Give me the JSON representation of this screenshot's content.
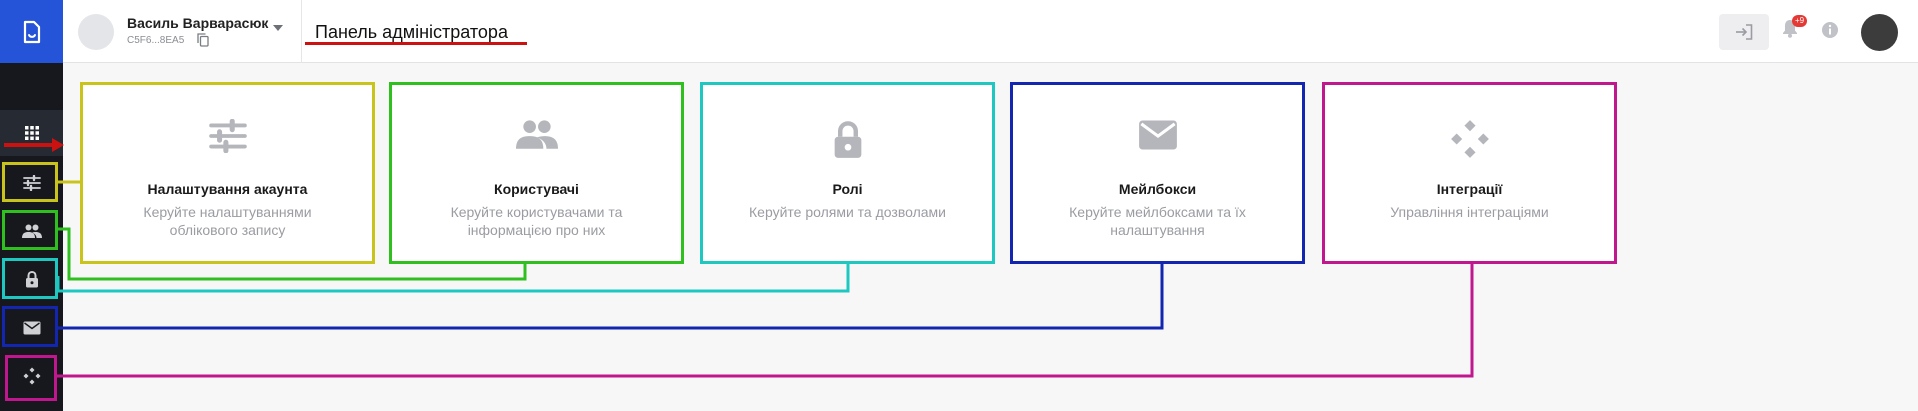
{
  "colors": {
    "logo_bg": "#2554d8",
    "sidebar_bg": "#16181d",
    "card_account": "#c9c41b",
    "card_users": "#2fbf1f",
    "card_roles": "#1ec8c0",
    "card_mailboxes": "#1226b0",
    "card_integrations": "#c0168e",
    "arrow": "#cc1111"
  },
  "header": {
    "user_name": "Василь Варварасюк",
    "user_id": "C5F6...8EA5",
    "page_title": "Панель адміністратора",
    "notifications_badge": "+9"
  },
  "sidebar": {
    "items": [
      {
        "icon": "grid-icon"
      },
      {
        "icon": "sliders-icon"
      },
      {
        "icon": "users-icon"
      },
      {
        "icon": "lock-icon"
      },
      {
        "icon": "mail-icon"
      },
      {
        "icon": "integrations-icon"
      }
    ]
  },
  "cards": [
    {
      "icon": "sliders-icon",
      "title": "Налаштування акаунта",
      "desc": "Керуйте налаштуваннями облікового запису"
    },
    {
      "icon": "users-icon",
      "title": "Користувачі",
      "desc": "Керуйте користувачами та інформацією про них"
    },
    {
      "icon": "lock-icon",
      "title": "Ролі",
      "desc": "Керуйте ролями та дозволами"
    },
    {
      "icon": "mail-icon",
      "title": "Мейлбокси",
      "desc": "Керуйте мейлбоксами та їх налаштування"
    },
    {
      "icon": "integrations-icon",
      "title": "Інтеграції",
      "desc": "Управління інтеграціями"
    }
  ]
}
